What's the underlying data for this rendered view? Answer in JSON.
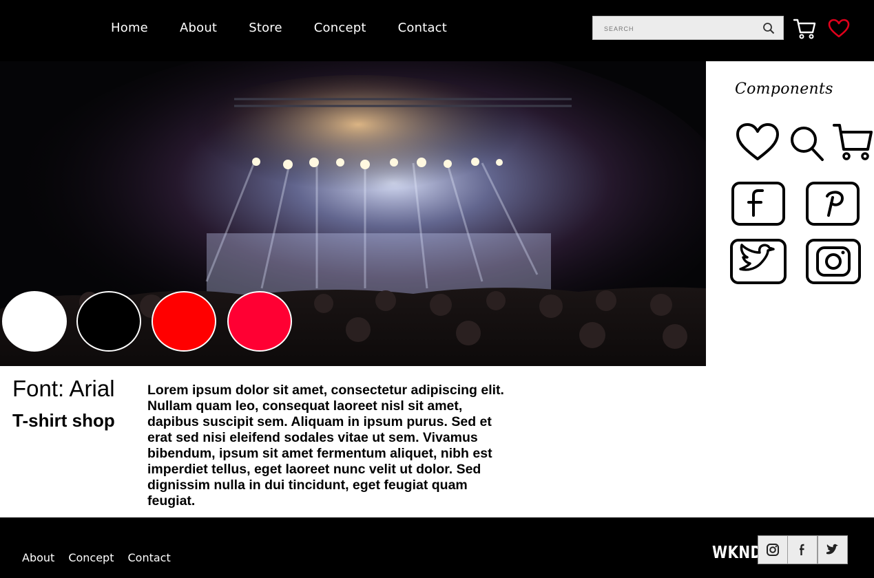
{
  "header": {
    "nav": [
      "Home",
      "About",
      "Store",
      "Concept",
      "Contact"
    ],
    "search_placeholder": "SEARCH"
  },
  "icons": {
    "header": [
      "search-icon",
      "cart-icon",
      "heart-icon"
    ],
    "components": [
      "heart-icon",
      "search-icon",
      "cart-icon",
      "facebook-icon",
      "pinterest-icon",
      "twitter-icon",
      "instagram-icon"
    ],
    "footer_social": [
      "instagram-icon",
      "facebook-icon",
      "twitter-icon"
    ]
  },
  "colors": {
    "accent_heart": "#e0001b",
    "swatches": [
      "#ffffff",
      "#000000",
      "#ff0000",
      "#ff0033"
    ]
  },
  "components": {
    "title": "Components"
  },
  "info": {
    "font_title": "Font: Arial",
    "shop_title": "T-shirt shop",
    "lorem": "Lorem ipsum dolor sit amet, consectetur adipiscing elit. Nullam quam leo, consequat laoreet nisl sit amet, dapibus suscipit sem. Aliquam in ipsum purus. Sed et erat sed nisi eleifend sodales vitae ut sem. Vivamus bibendum, ipsum sit amet fermentum aliquet, nibh est imperdiet tellus, eget laoreet nunc velit ut dolor. Sed dignissim nulla in dui tincidunt, eget feugiat quam feugiat."
  },
  "footer": {
    "nav": [
      "About",
      "Concept",
      "Contact"
    ],
    "brand": "WKND"
  }
}
